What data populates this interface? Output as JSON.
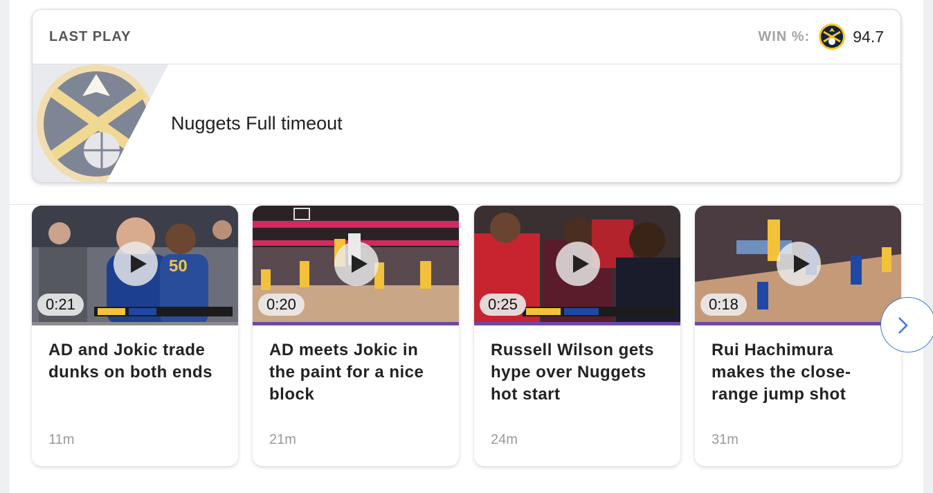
{
  "last_play": {
    "title": "LAST PLAY",
    "win_label": "WIN %:",
    "win_value": "94.7",
    "team_logo": "nuggets-logo",
    "description": "Nuggets Full timeout"
  },
  "videos": [
    {
      "duration": "0:21",
      "title": "AD and Jokic trade dunks on both ends",
      "age": "11m"
    },
    {
      "duration": "0:20",
      "title": "AD meets Jokic in the paint for a nice block",
      "age": "21m"
    },
    {
      "duration": "0:25",
      "title": "Russell Wilson gets hype over Nuggets hot start",
      "age": "24m"
    },
    {
      "duration": "0:18",
      "title": "Rui Hachimura makes the close-range jump shot",
      "age": "31m"
    }
  ],
  "icons": {
    "play": "play-icon",
    "next": "chevron-right-icon"
  },
  "colors": {
    "accent": "#3a78d6",
    "progress": "#6b4aa6",
    "nuggets_navy": "#0e2240",
    "nuggets_gold": "#fec524"
  }
}
